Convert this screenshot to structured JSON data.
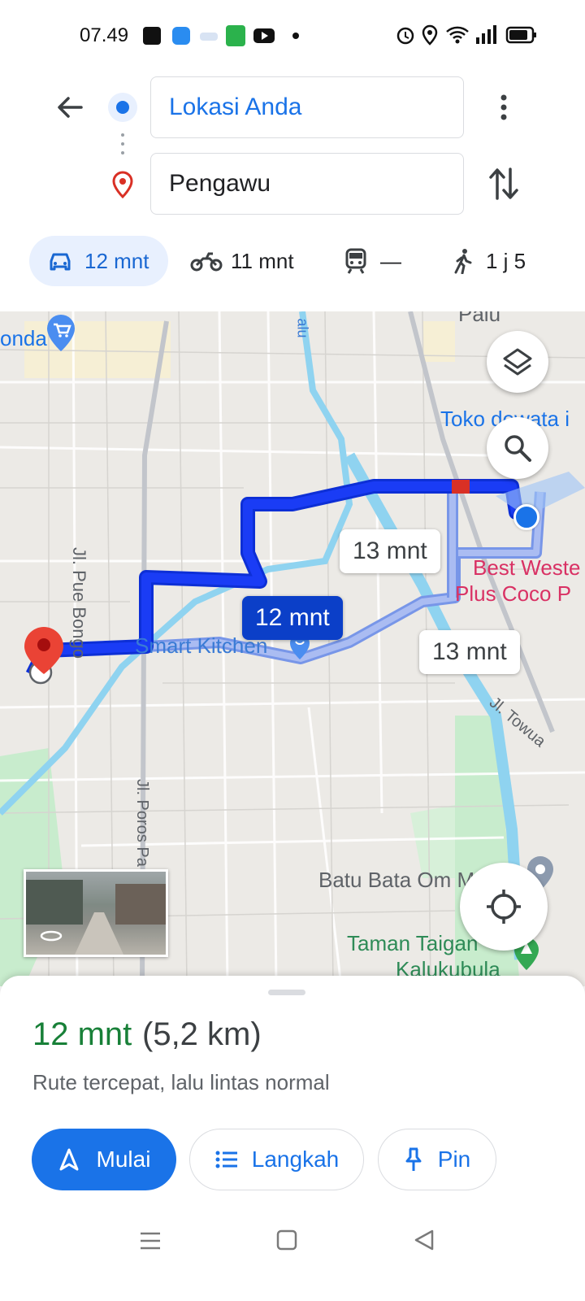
{
  "status_bar": {
    "time": "07.49",
    "notification_icons": [
      "shopee-icon",
      "app-icon-blue",
      "app-icon-small",
      "app-icon-green",
      "youtube-icon",
      "dot-icon"
    ],
    "system_icons": [
      "alarm-icon",
      "location-icon",
      "wifi-icon",
      "signal-icon",
      "battery-icon"
    ]
  },
  "directions": {
    "origin": "Lokasi Anda",
    "destination": "Pengawu"
  },
  "travel_modes": [
    {
      "mode": "car",
      "icon": "car-icon",
      "label": "12 mnt",
      "selected": true
    },
    {
      "mode": "motorcycle",
      "icon": "motorcycle-icon",
      "label": "11 mnt",
      "selected": false
    },
    {
      "mode": "transit",
      "icon": "train-icon",
      "label": "—",
      "selected": false
    },
    {
      "mode": "walk",
      "icon": "walk-icon",
      "label": "1 j 5",
      "selected": false
    }
  ],
  "map": {
    "labels": {
      "onda": "onda",
      "palu": "Palu",
      "river": "alu",
      "toko": "Toko dewata i",
      "best_western_1": "Best Weste",
      "best_western_2": "Plus Coco P",
      "jl_pue_bongo": "Jl. Pue Bongo",
      "smart_kitchen": "Smart Kitchen",
      "jl_towua": "Jl. Towua",
      "jl_poros": "Jl. Poros Pa",
      "batu_bata": "Batu Bata Om M",
      "taman_1": "Taman Taigan",
      "taman_2": "Kalukubula"
    },
    "routes": {
      "main": "12 mnt",
      "alt_1": "13 mnt",
      "alt_2": "13 mnt"
    },
    "colors": {
      "route_main": "#1a3cf5",
      "route_alt": "#9bb0f0",
      "river": "#8fd3f0",
      "park": "#c8eccd"
    }
  },
  "summary": {
    "duration": "12 mnt",
    "distance": "(5,2 km)",
    "description": "Rute tercepat, lalu lintas normal"
  },
  "actions": {
    "start": "Mulai",
    "steps": "Langkah",
    "pin": "Pin"
  }
}
